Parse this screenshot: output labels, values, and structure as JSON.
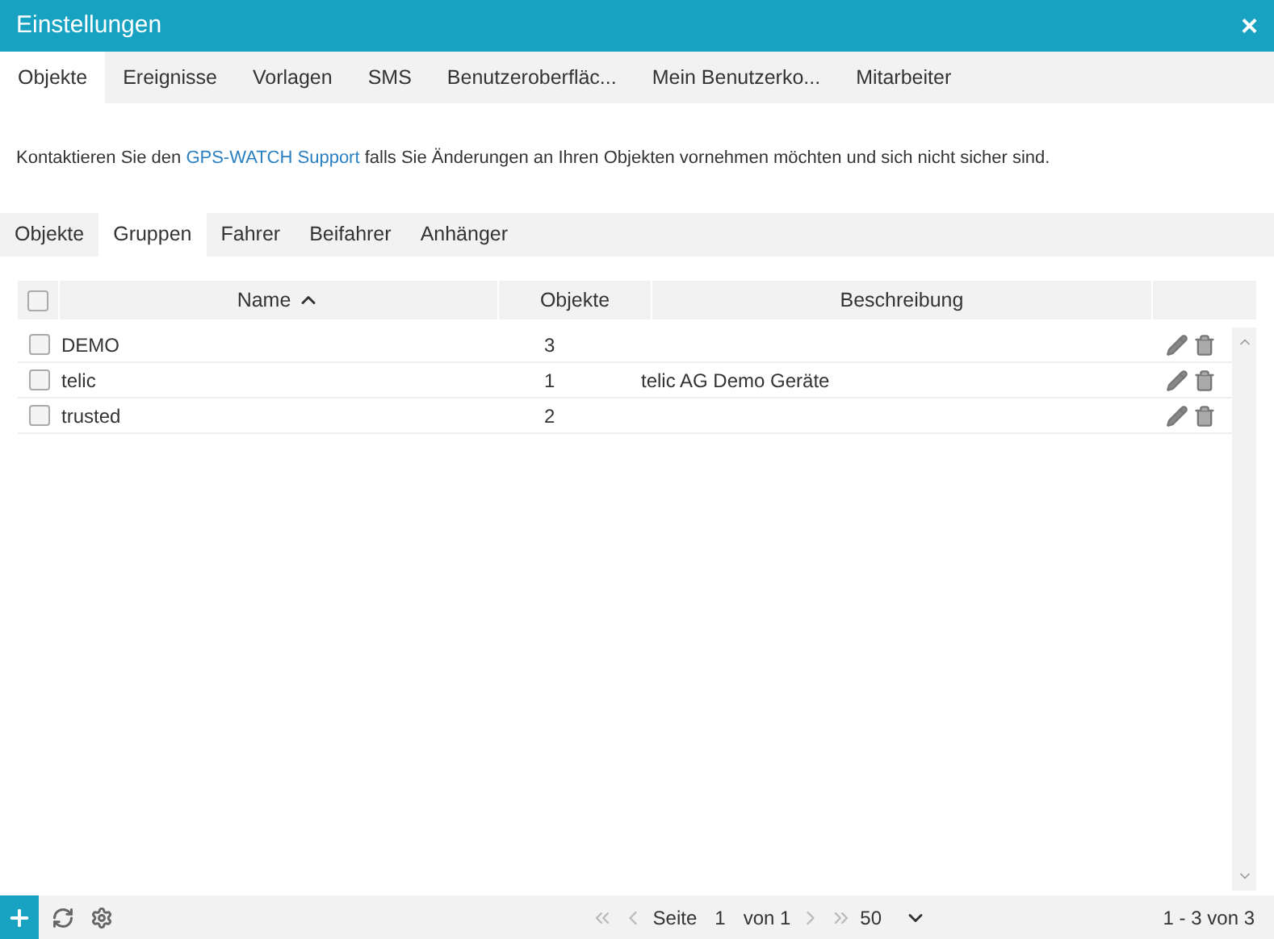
{
  "window": {
    "title": "Einstellungen",
    "close": "×"
  },
  "tabs": [
    {
      "label": "Objekte",
      "selected": true
    },
    {
      "label": "Ereignisse",
      "selected": false
    },
    {
      "label": "Vorlagen",
      "selected": false
    },
    {
      "label": "SMS",
      "selected": false
    },
    {
      "label": "Benutzeroberfläc...",
      "selected": false
    },
    {
      "label": "Mein Benutzerko...",
      "selected": false
    },
    {
      "label": "Mitarbeiter",
      "selected": false
    }
  ],
  "info": {
    "before": "Kontaktieren Sie den",
    "link": "GPS-WATCH Support",
    "after": "falls Sie Änderungen an Ihren Objekten vornehmen möchten und sich nicht sicher sind."
  },
  "subtabs": [
    {
      "label": "Objekte",
      "selected": false
    },
    {
      "label": "Gruppen",
      "selected": true
    },
    {
      "label": "Fahrer",
      "selected": false
    },
    {
      "label": "Beifahrer",
      "selected": false
    },
    {
      "label": "Anhänger",
      "selected": false
    }
  ],
  "table": {
    "all_checked": false,
    "columns": [
      "Name",
      "Objekte",
      "Beschreibung"
    ],
    "rows": [
      {
        "checked": false,
        "name": "DEMO",
        "count": "3",
        "description": ""
      },
      {
        "checked": false,
        "name": "telic",
        "count": "1",
        "description": "telic AG Demo Geräte"
      },
      {
        "checked": false,
        "name": "trusted",
        "count": "2",
        "description": ""
      }
    ]
  },
  "pager": {
    "page_label": "Seite",
    "page": "1",
    "of": "von 1",
    "page_size": "50",
    "summary": "1 - 3 von 3"
  }
}
